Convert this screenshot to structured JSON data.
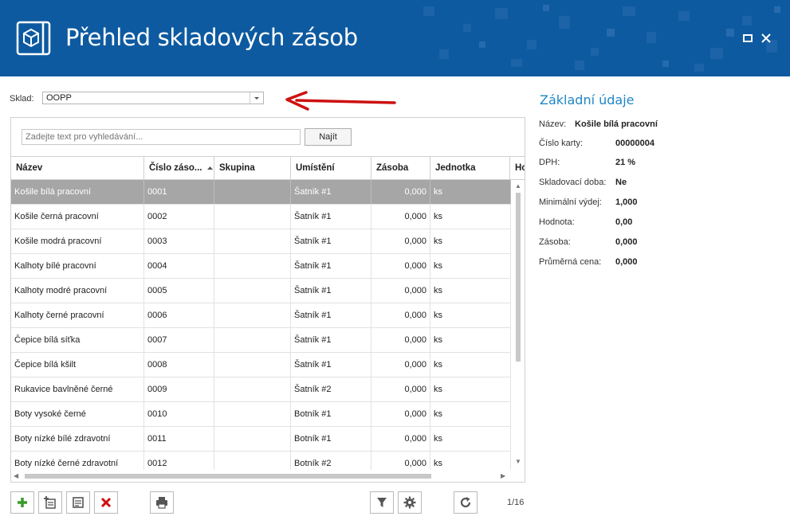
{
  "window": {
    "title": "Přehled skladových zásob"
  },
  "filter": {
    "sklad_label": "Sklad:",
    "sklad_value": "OOPP"
  },
  "search": {
    "placeholder": "Zadejte text pro vyhledávání...",
    "button_label": "Najít"
  },
  "grid": {
    "columns": [
      "Název",
      "Číslo záso...",
      "Skupina",
      "Umístění",
      "Zásoba",
      "Jednotka",
      "Ho"
    ],
    "sorted_column": "Číslo záso...",
    "rows": [
      {
        "nazev": "Košile bílá pracovní",
        "cislo": "0001",
        "skupina": "",
        "umisteni": "Šatník #1",
        "zasoba": "0,000",
        "jednotka": "ks"
      },
      {
        "nazev": "Košile černá pracovní",
        "cislo": "0002",
        "skupina": "",
        "umisteni": "Šatník #1",
        "zasoba": "0,000",
        "jednotka": "ks"
      },
      {
        "nazev": "Košile modrá pracovní",
        "cislo": "0003",
        "skupina": "",
        "umisteni": "Šatník #1",
        "zasoba": "0,000",
        "jednotka": "ks"
      },
      {
        "nazev": "Kalhoty bílé pracovní",
        "cislo": "0004",
        "skupina": "",
        "umisteni": "Šatník #1",
        "zasoba": "0,000",
        "jednotka": "ks"
      },
      {
        "nazev": "Kalhoty modré pracovní",
        "cislo": "0005",
        "skupina": "",
        "umisteni": "Šatník #1",
        "zasoba": "0,000",
        "jednotka": "ks"
      },
      {
        "nazev": "Kalhoty černé pracovní",
        "cislo": "0006",
        "skupina": "",
        "umisteni": "Šatník #1",
        "zasoba": "0,000",
        "jednotka": "ks"
      },
      {
        "nazev": "Čepice bílá síťka",
        "cislo": "0007",
        "skupina": "",
        "umisteni": "Šatník #1",
        "zasoba": "0,000",
        "jednotka": "ks"
      },
      {
        "nazev": "Čepice bílá kšilt",
        "cislo": "0008",
        "skupina": "",
        "umisteni": "Šatník #1",
        "zasoba": "0,000",
        "jednotka": "ks"
      },
      {
        "nazev": "Rukavice bavlněné černé",
        "cislo": "0009",
        "skupina": "",
        "umisteni": "Šatník #2",
        "zasoba": "0,000",
        "jednotka": "ks"
      },
      {
        "nazev": "Boty vysoké černé",
        "cislo": "0010",
        "skupina": "",
        "umisteni": "Botník #1",
        "zasoba": "0,000",
        "jednotka": "ks"
      },
      {
        "nazev": "Boty nízké bílé zdravotní",
        "cislo": "0011",
        "skupina": "",
        "umisteni": "Botník #1",
        "zasoba": "0,000",
        "jednotka": "ks"
      },
      {
        "nazev": "Boty nízké černé zdravotní",
        "cislo": "0012",
        "skupina": "",
        "umisteni": "Botník #2",
        "zasoba": "0,000",
        "jednotka": "ks"
      }
    ]
  },
  "pager": {
    "text": "1/16"
  },
  "details": {
    "title": "Základní údaje",
    "fields": [
      {
        "label": "Název:",
        "value": "Košile bílá pracovní"
      },
      {
        "label": "Číslo karty:",
        "value": "00000004"
      },
      {
        "label": "DPH:",
        "value": "21 %"
      },
      {
        "label": "Skladovací doba:",
        "value": "Ne"
      },
      {
        "label": "Minimální výdej:",
        "value": "1,000"
      },
      {
        "label": "Hodnota:",
        "value": "0,00"
      },
      {
        "label": "Zásoba:",
        "value": "0,000"
      },
      {
        "label": "Průměrná cena:",
        "value": "0,000"
      }
    ]
  },
  "colors": {
    "header_bg": "#0d5aa0",
    "accent": "#1f86c6",
    "selected_row": "#a6a6a6",
    "arrow_red": "#cc1111"
  },
  "icons": {
    "app": "warehouse-box-icon",
    "toolbar": [
      "add-icon",
      "add-subitem-icon",
      "edit-icon",
      "delete-icon",
      "print-icon",
      "filter-icon",
      "settings-icon",
      "refresh-icon"
    ]
  }
}
